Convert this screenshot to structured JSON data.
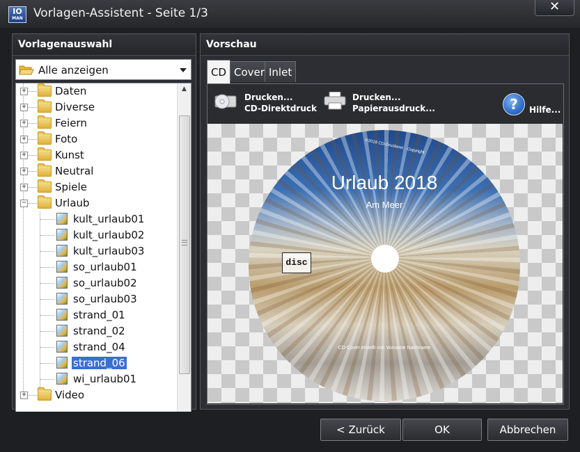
{
  "window": {
    "title": "Vorlagen-Assistent - Seite 1/3",
    "app_icon_text": "IO",
    "app_icon_subtext": "MAN",
    "close_label": "✕"
  },
  "left_panel": {
    "header": "Vorlagenauswahl",
    "filter": {
      "selected": "Alle anzeigen"
    },
    "tree": {
      "folders_top": [
        {
          "label": "Daten",
          "expander": "+"
        },
        {
          "label": "Diverse",
          "expander": "+"
        },
        {
          "label": "Feiern",
          "expander": "+"
        },
        {
          "label": "Foto",
          "expander": "+"
        },
        {
          "label": "Kunst",
          "expander": "+"
        },
        {
          "label": "Neutral",
          "expander": "+"
        },
        {
          "label": "Spiele",
          "expander": "+"
        },
        {
          "label": "Urlaub",
          "expander": "−"
        }
      ],
      "urlaub_children": [
        "kult_urlaub01",
        "kult_urlaub02",
        "kult_urlaub03",
        "so_urlaub01",
        "so_urlaub02",
        "so_urlaub03",
        "strand_01",
        "strand_02",
        "strand_04",
        "strand_06",
        "wi_urlaub01"
      ],
      "selected": "strand_06",
      "folders_bottom": [
        {
          "label": "Video",
          "expander": "+"
        }
      ]
    }
  },
  "right_panel": {
    "header": "Vorschau",
    "tabs": [
      {
        "label": "CD",
        "active": true
      },
      {
        "label": "Cover",
        "active": false
      },
      {
        "label": "Inlet",
        "active": false
      }
    ],
    "toolbar": {
      "direct_print_line1": "Drucken...",
      "direct_print_line2": "CD-Direktdruck",
      "paper_print_line1": "Drucken...",
      "paper_print_line2": "Papierausdruck...",
      "help_label": "Hilfe...",
      "help_icon_glyph": "?"
    },
    "disc": {
      "title": "Urlaub 2018",
      "subtitle": "Am Meer",
      "credit": "CD-Cover erstellt von Vorname Nachname",
      "logo_text": "disc",
      "copyright": "©2018 CD-Druckerei · Copyright"
    }
  },
  "buttons": {
    "back": "< Zurück",
    "ok": "OK",
    "cancel": "Abbrechen"
  },
  "colors": {
    "window_bg": "#1d1f23",
    "selection": "#3a6fd2",
    "help_icon": "#2f6ec9"
  }
}
